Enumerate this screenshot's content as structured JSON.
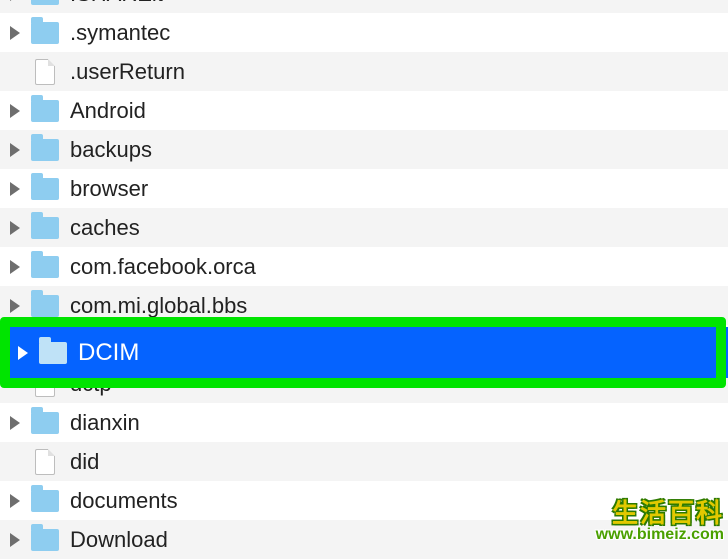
{
  "rows": [
    {
      "label": ".SHAREit",
      "type": "folder",
      "expandable": true,
      "partial": true
    },
    {
      "label": ".symantec",
      "type": "folder",
      "expandable": true
    },
    {
      "label": ".userReturn",
      "type": "file",
      "expandable": false
    },
    {
      "label": "Android",
      "type": "folder",
      "expandable": true
    },
    {
      "label": "backups",
      "type": "folder",
      "expandable": true
    },
    {
      "label": "browser",
      "type": "folder",
      "expandable": true
    },
    {
      "label": "caches",
      "type": "folder",
      "expandable": true
    },
    {
      "label": "com.facebook.orca",
      "type": "folder",
      "expandable": true
    },
    {
      "label": "com.mi.global.bbs",
      "type": "folder",
      "expandable": true,
      "covered": true
    },
    {
      "label": "DCIM",
      "type": "folder",
      "expandable": true,
      "selected": true
    },
    {
      "label": "dctp",
      "type": "file",
      "expandable": false
    },
    {
      "label": "dianxin",
      "type": "folder",
      "expandable": true
    },
    {
      "label": "did",
      "type": "file",
      "expandable": false
    },
    {
      "label": "documents",
      "type": "folder",
      "expandable": true
    },
    {
      "label": "Download",
      "type": "folder",
      "expandable": true,
      "partial": true
    }
  ],
  "watermark": {
    "title": "生活百科",
    "url": "www.bimeiz.com"
  }
}
